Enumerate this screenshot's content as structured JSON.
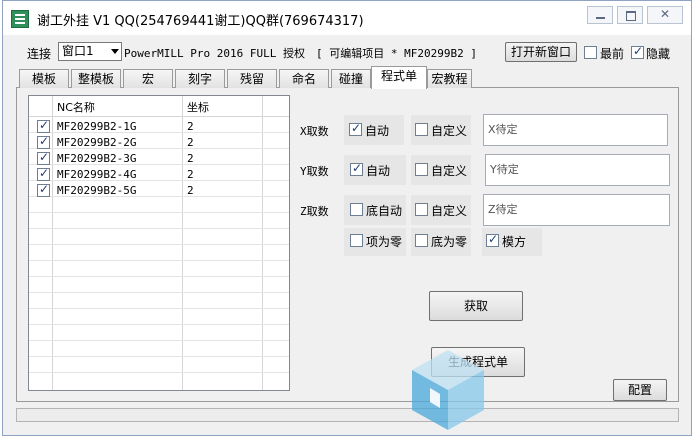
{
  "window": {
    "title": "谢工外挂 V1 QQ(254769441谢工)QQ群(769674317)"
  },
  "toolbar": {
    "connect_label": "连接",
    "window_select_value": "窗口1",
    "product_text": "PowerMILL Pro 2016 FULL 授权",
    "project_text": "[ 可编辑项目 * MF20299B2 ]",
    "open_window_button": "打开新窗口",
    "topmost_label": "最前",
    "topmost_checked": false,
    "hide_label": "隐藏",
    "hide_checked": true
  },
  "tabs": [
    {
      "label": "模板",
      "active": false
    },
    {
      "label": "整模板",
      "active": false
    },
    {
      "label": "宏",
      "active": false
    },
    {
      "label": "刻字",
      "active": false
    },
    {
      "label": "残留",
      "active": false
    },
    {
      "label": "命名",
      "active": false
    },
    {
      "label": "碰撞",
      "active": false
    },
    {
      "label": "程式单",
      "active": true
    },
    {
      "label": "宏教程",
      "active": false
    }
  ],
  "grid": {
    "columns": [
      "NC名称",
      "坐标"
    ],
    "rows": [
      {
        "checked": true,
        "name": "MF20299B2-1G",
        "coord": "2"
      },
      {
        "checked": true,
        "name": "MF20299B2-2G",
        "coord": "2"
      },
      {
        "checked": true,
        "name": "MF20299B2-3G",
        "coord": "2"
      },
      {
        "checked": true,
        "name": "MF20299B2-4G",
        "coord": "2"
      },
      {
        "checked": true,
        "name": "MF20299B2-5G",
        "coord": "2"
      }
    ]
  },
  "x_row": {
    "label": "X取数",
    "auto_label": "自动",
    "auto_checked": true,
    "custom_label": "自定义",
    "custom_checked": false,
    "placeholder": "X待定"
  },
  "y_row": {
    "label": "Y取数",
    "auto_label": "自动",
    "auto_checked": true,
    "custom_label": "自定义",
    "custom_checked": false,
    "placeholder": "Y待定"
  },
  "z_row": {
    "label": "Z取数",
    "auto_label": "底自动",
    "auto_checked": false,
    "custom_label": "自定义",
    "custom_checked": false,
    "placeholder": "Z待定"
  },
  "options": {
    "top_zero_label": "项为零",
    "top_zero_checked": false,
    "bottom_zero_label": "底为零",
    "bottom_zero_checked": false,
    "mold_square_label": "模方",
    "mold_square_checked": true
  },
  "actions": {
    "fetch_button": "获取",
    "generate_button": "生成程式单",
    "config_button": "配置"
  }
}
